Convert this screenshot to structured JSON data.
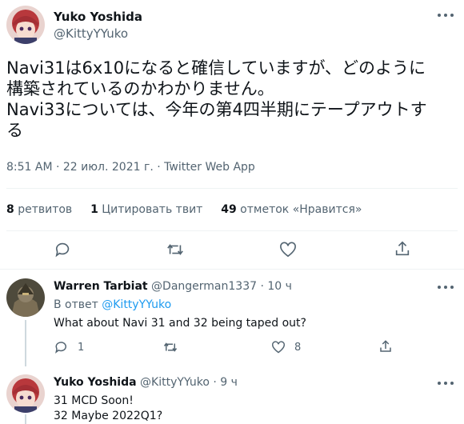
{
  "main_tweet": {
    "author_name": "Yuko Yoshida",
    "author_handle": "@KittyYYuko",
    "text_line1": "Navi31は6x10になると確信していますが、どのように",
    "text_line2": "構築されているのかわかりません。",
    "text_line3": "Navi33については、今年の第4四半期にテープアウトす",
    "text_line4": "る",
    "timestamp": "8:51 AM · 22 июл. 2021 г. · Twitter Web App",
    "stats": {
      "retweets_count": "8",
      "retweets_label": "ретвитов",
      "quotes_count": "1",
      "quotes_label": "Цитировать твит",
      "likes_count": "49",
      "likes_label": "отметок «Нравится»"
    },
    "icons": [
      "reply-icon",
      "retweet-icon",
      "like-icon",
      "share-icon"
    ]
  },
  "replies": [
    {
      "author_name": "Warren Tarbiat",
      "author_handle": "@Dangerman1337",
      "time": "· 10 ч",
      "reply_to_prefix": "В ответ",
      "reply_to_handle": "@KittyYYuko",
      "text": "What about Navi 31 and 32 being taped out?",
      "reply_count": "1",
      "like_count": "8"
    },
    {
      "author_name": "Yuko Yoshida",
      "author_handle": "@KittyYYuko",
      "time": "· 9 ч",
      "text_line1": "31 MCD Soon!",
      "text_line2": "32 Maybe 2022Q1?"
    }
  ],
  "colors": {
    "accent": "#1d9bf0",
    "muted": "#536471",
    "divider": "#eff3f4"
  }
}
